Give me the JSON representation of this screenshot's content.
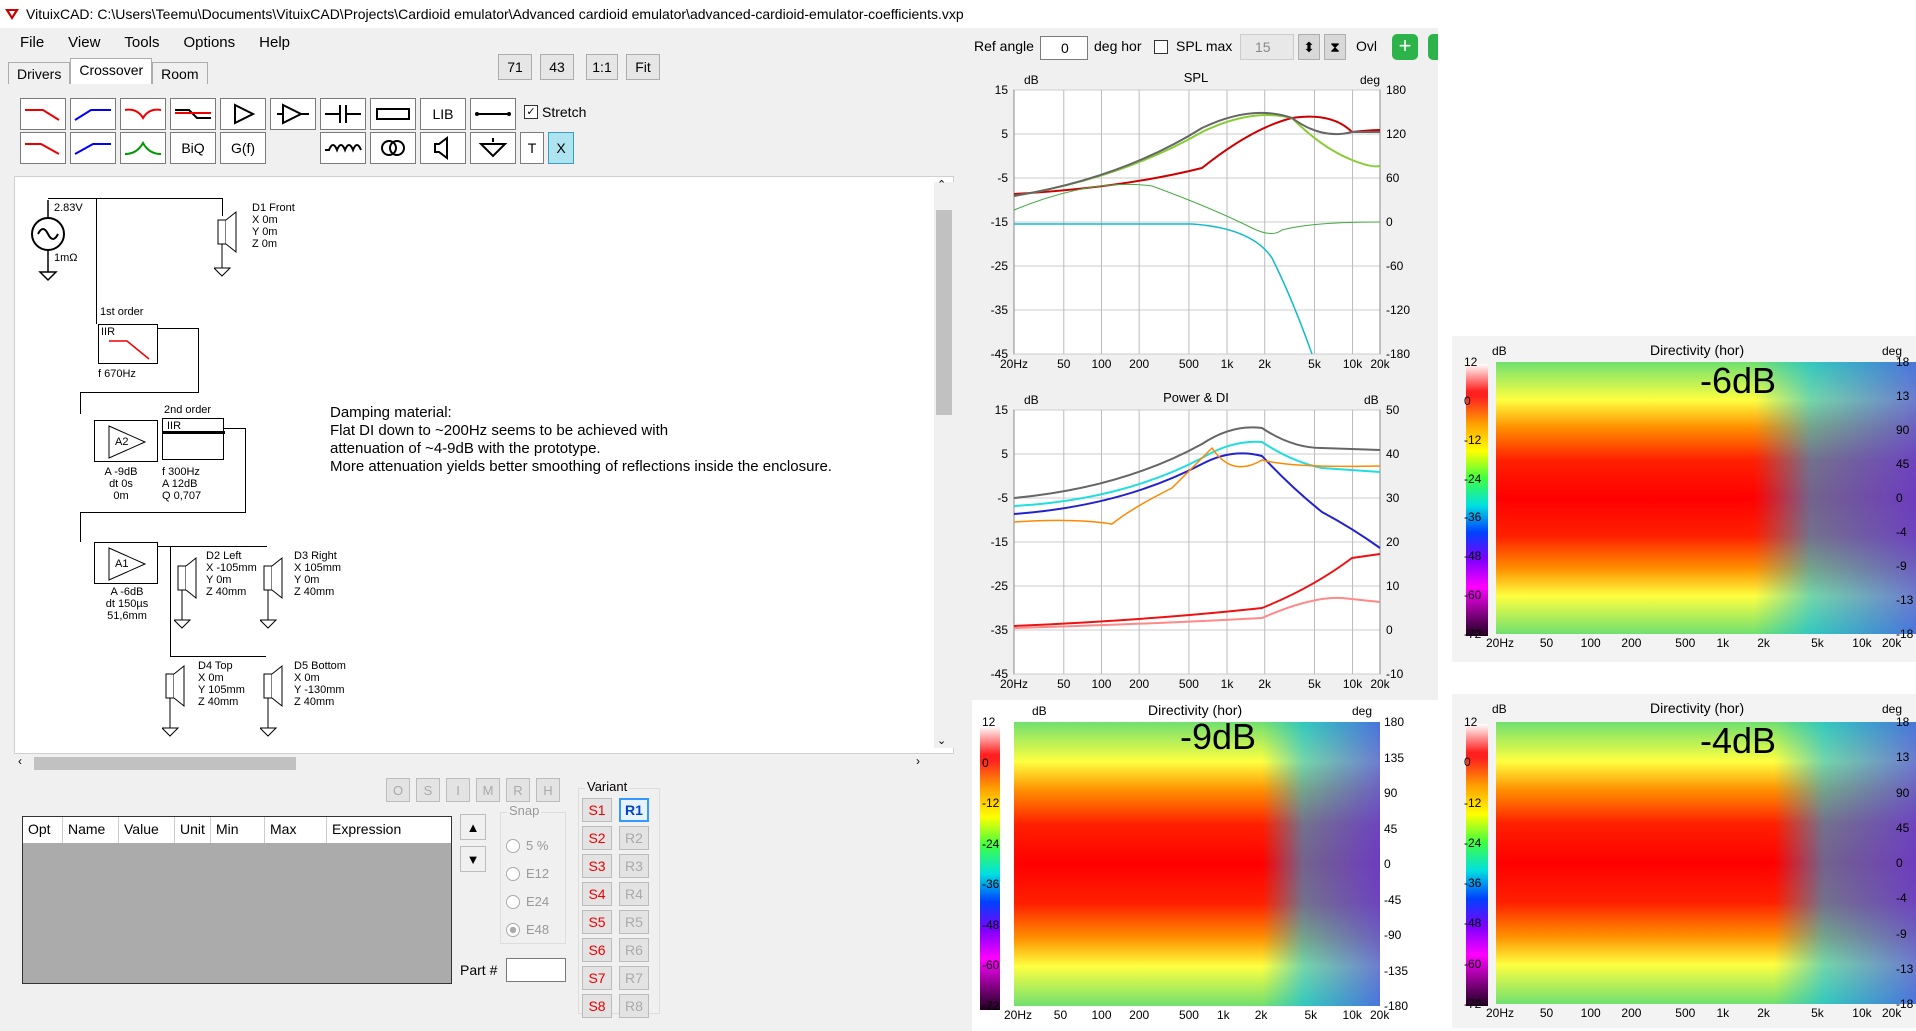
{
  "window": {
    "title": "VituixCAD: C:\\Users\\Teemu\\Documents\\VituixCAD\\Projects\\Cardioid emulator\\Advanced cardioid emulator\\advanced-cardioid-emulator-coefficients.vxp"
  },
  "menu": [
    "File",
    "View",
    "Tools",
    "Options",
    "Help"
  ],
  "tabs": [
    "Drivers",
    "Crossover",
    "Room"
  ],
  "zoom_buttons": [
    "71",
    "43",
    "1:1",
    "Fit"
  ],
  "toolbar": {
    "lib": "LIB",
    "biq": "BiQ",
    "gf": "G(f)",
    "t": "T",
    "x": "X",
    "stretch": "Stretch"
  },
  "schematic": {
    "gen_voltage": "2.83V",
    "gen_impedance": "1mΩ",
    "d1": [
      "D1 Front",
      "X 0m",
      "Y 0m",
      "Z 0m"
    ],
    "iir1_title": "1st order",
    "iir1_label": "IIR",
    "iir1_f": "f  670Hz",
    "iir2_title": "2nd order",
    "iir2_label": "IIR",
    "iir2_params": [
      "f  300Hz",
      "A  12dB",
      "Q 0,707"
    ],
    "a2_label": "A2",
    "a2_params": [
      "A -9dB",
      "dt 0s",
      "0m"
    ],
    "a1_label": "A1",
    "a1_params": [
      "A -6dB",
      "dt 150µs",
      "51,6mm"
    ],
    "d2": [
      "D2 Left",
      "X -105mm",
      "Y 0m",
      "Z 40mm"
    ],
    "d3": [
      "D3 Right",
      "X 105mm",
      "Y 0m",
      "Z 40mm"
    ],
    "d4": [
      "D4 Top",
      "X 0m",
      "Y 105mm",
      "Z 40mm"
    ],
    "d5": [
      "D5 Bottom",
      "X 0m",
      "Y -130mm",
      "Z 40mm"
    ],
    "note": [
      "Damping material:",
      "Flat DI down to ~200Hz seems to be achieved with",
      "attenuation of ~4-9dB with the prototype.",
      "More attenuation yields better smoothing of reflections inside the enclosure."
    ]
  },
  "optim_buttons": [
    "O",
    "S",
    "I",
    "M",
    "R",
    "H"
  ],
  "table_headers": [
    "Opt",
    "Name",
    "Value",
    "Unit",
    "Min",
    "Max",
    "Expression"
  ],
  "snap": {
    "label": "Snap",
    "options": [
      "5 %",
      "E12",
      "E24",
      "E48"
    ]
  },
  "part_label": "Part #",
  "variant": {
    "label": "Variant",
    "s": [
      "S1",
      "S2",
      "S3",
      "S4",
      "S5",
      "S6",
      "S7",
      "S8"
    ],
    "r": [
      "R1",
      "R2",
      "R3",
      "R4",
      "R5",
      "R6",
      "R7",
      "R8"
    ]
  },
  "top_controls": {
    "ref_angle_label": "Ref angle",
    "ref_angle_value": "0",
    "deg_hor": "deg hor",
    "spl_max": "SPL max",
    "spl_value": "15",
    "ovl": "Ovl"
  },
  "graphs": {
    "spl": {
      "title": "SPL",
      "yl": [
        "15",
        "5",
        "-5",
        "-15",
        "-25",
        "-35",
        "-45"
      ],
      "yr": [
        "180",
        "120",
        "60",
        "0",
        "-60",
        "-120",
        "-180"
      ],
      "unit_l": "dB",
      "unit_r": "deg"
    },
    "power": {
      "title": "Power & DI",
      "yl": [
        "15",
        "5",
        "-5",
        "-15",
        "-25",
        "-35",
        "-45"
      ],
      "yr": [
        "50",
        "40",
        "30",
        "20",
        "10",
        "0",
        "-10"
      ],
      "unit_l": "dB",
      "unit_r": "dB"
    },
    "dir": {
      "title": "Directivity (hor)",
      "yl": [
        "12",
        "0",
        "-12",
        "-24",
        "-36",
        "-48",
        "-60",
        "-72"
      ],
      "yr": [
        "180",
        "135",
        "90",
        "45",
        "0",
        "-45",
        "-90",
        "-135",
        "-180"
      ],
      "unit_l": "dB",
      "unit_r": "deg"
    },
    "x_ticks": [
      "20Hz",
      "50",
      "100",
      "200",
      "500",
      "1k",
      "2k",
      "5k",
      "10k",
      "20k"
    ]
  },
  "overlays": {
    "dir_main": "-9dB",
    "dir_top": "-6dB",
    "dir_bottom": "-4dB"
  },
  "side_dir_yr_top": [
    "18",
    "13",
    "90",
    "45",
    "0",
    "-4",
    "-9",
    "-13",
    "-18"
  ],
  "side_dir_yr_bottom": [
    "18",
    "13",
    "90",
    "45",
    "0",
    "-4",
    "-9",
    "-13",
    "-18"
  ]
}
